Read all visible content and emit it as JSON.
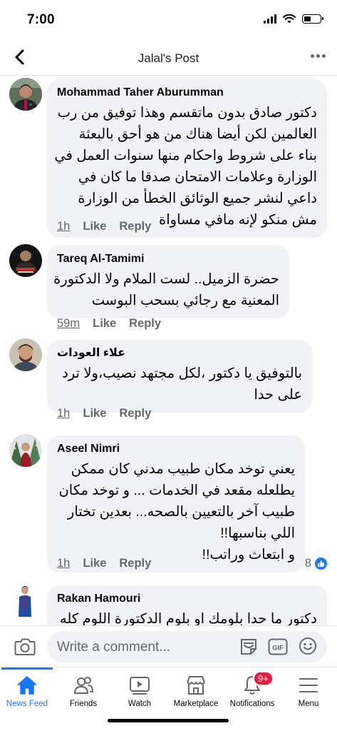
{
  "status_bar": {
    "time": "7:00"
  },
  "header": {
    "title": "Jalal's Post"
  },
  "comments": [
    {
      "name": "Mohammad Taher Aburumman",
      "lines": [
        "دكتور صادق بدون ماتقسم وهذا توفيق من رب",
        "العالمين لكن أيضا هناك من هو أحق بالبعثة",
        "بناء على شروط واحكام منها سنوات العمل في",
        "الوزارة وعلامات الامتحان صدقا ما كان في",
        "داعي لنشر جميع الوثائق الخطأ من الوزارة",
        "مش منكو لإنه مافي مساواة"
      ],
      "time": "1h",
      "like": "Like",
      "reply": "Reply"
    },
    {
      "name": "Tareq Al-Tamimi",
      "lines": [
        "حضرة الزميل.. لست الملام ولا الدكتورة",
        "المعنية مع رجائي بسحب البوست"
      ],
      "time": "59m",
      "like": "Like",
      "reply": "Reply"
    },
    {
      "name": "علاء العودات",
      "lines": [
        "بالتوفيق يا دكتور ،لكل مجتهد نصيب،ولا ترد",
        "على حدا"
      ],
      "time": "1h",
      "like": "Like",
      "reply": "Reply"
    },
    {
      "name": "Aseel Nimri",
      "lines": [
        "يعني توخد مكان طبيب مدني كان ممكن",
        "يطلعله مقعد في الخدمات ... و توخد مكان",
        "طبيب آخر بالتعيين بالصحه... بعدين تختار",
        "اللي بناسبها!!",
        "و ابتعاث وراتب!!"
      ],
      "time": "1h",
      "like": "Like",
      "reply": "Reply",
      "reaction_count": "8"
    },
    {
      "name": "Rakan Hamouri",
      "lines": [
        "دكتور ما حدا بلومك او بلوم الدكتورة اللوم كله"
      ]
    }
  ],
  "composer": {
    "placeholder": "Write a comment..."
  },
  "tabs": [
    {
      "label": "News Feed",
      "icon": "home-icon"
    },
    {
      "label": "Friends",
      "icon": "friends-icon"
    },
    {
      "label": "Watch",
      "icon": "watch-icon"
    },
    {
      "label": "Marketplace",
      "icon": "marketplace-icon"
    },
    {
      "label": "Notifications",
      "icon": "bell-icon",
      "badge": "9+"
    },
    {
      "label": "Menu",
      "icon": "menu-icon"
    }
  ],
  "colors": {
    "accent": "#1877f2",
    "bubble": "#f0f2f5",
    "muted": "#65676b",
    "badge": "#e41e3f"
  }
}
